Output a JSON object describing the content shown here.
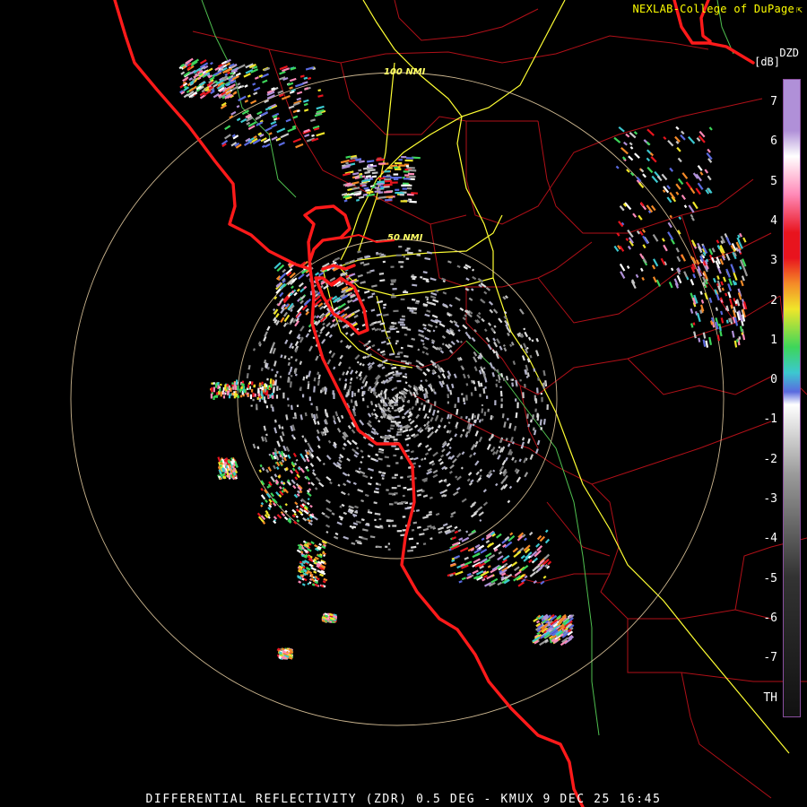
{
  "header": {
    "credit": "NEXLAB-College of DuPage",
    "credit_icon": "external-link-icon"
  },
  "legend": {
    "product": "DZD",
    "unit": "[dB]",
    "ticks": [
      "7",
      "6",
      "5",
      "4",
      "3",
      "2",
      "1",
      "0",
      "-1",
      "-2",
      "-3",
      "-4",
      "-5",
      "-6",
      "-7",
      "TH"
    ],
    "range_db": [
      -8,
      8
    ],
    "colors": {
      "low": "#ffffff",
      "negatives": "#9a9a9a",
      "zero": "#5a6adf",
      "cyan": "#3cc8d0",
      "green": "#3dd65a",
      "yellow": "#f0e62a",
      "orange": "#f48a28",
      "red": "#e8141e",
      "pink": "#ff8ab8",
      "violet": "#b090d8"
    }
  },
  "map": {
    "range_rings": [
      {
        "label": "50 NMI",
        "nmi": 50
      },
      {
        "label": "100 NMI",
        "nmi": 100
      }
    ],
    "colors": {
      "coastline": "#ff1a1a",
      "county_lines": "#b01018",
      "highways": "#ffff33",
      "rings": "#f0d6a8",
      "secondary_roads": "#66dd66"
    }
  },
  "footer": {
    "caption": "DIFFERENTIAL REFLECTIVITY (ZDR) 0.5 DEG - KMUX 9 DEC 25 16:45"
  }
}
